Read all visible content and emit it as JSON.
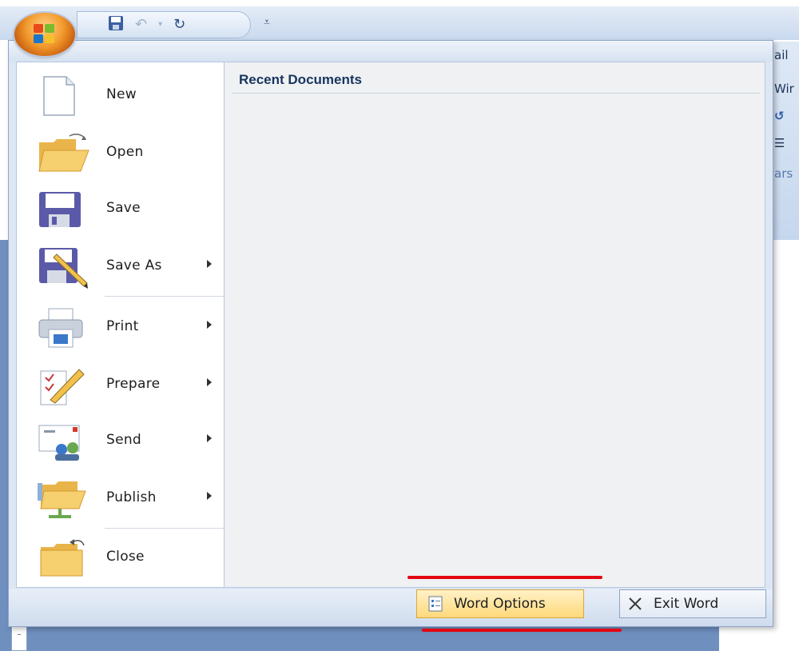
{
  "qat": {
    "save_icon": "save-icon",
    "undo_icon": "undo-icon",
    "dropdown_icon": "chevron-down-icon",
    "redo_icon": "redo-icon",
    "customize_icon": "customize-qat-icon"
  },
  "ribbon_fragments": [
    "ail",
    "Wir",
    "",
    "",
    "ars",
    "",
    ""
  ],
  "menu": {
    "recent_title": "Recent Documents",
    "items": [
      {
        "label": "New",
        "icon": "new-document-icon",
        "submenu": false
      },
      {
        "label": "Open",
        "icon": "open-folder-icon",
        "submenu": false
      },
      {
        "label": "Save",
        "icon": "save-disk-icon",
        "submenu": false
      },
      {
        "label": "Save As",
        "icon": "save-as-icon",
        "submenu": true
      },
      {
        "label": "Print",
        "icon": "printer-icon",
        "submenu": true
      },
      {
        "label": "Prepare",
        "icon": "prepare-icon",
        "submenu": true
      },
      {
        "label": "Send",
        "icon": "send-icon",
        "submenu": true
      },
      {
        "label": "Publish",
        "icon": "publish-icon",
        "submenu": true
      },
      {
        "label": "Close",
        "icon": "close-folder-icon",
        "submenu": false
      }
    ]
  },
  "buttons": {
    "options_label": "Word Options",
    "exit_label": "Exit Word"
  },
  "colors": {
    "annotation_red": "#e30613",
    "office_orange": "#f29a2c",
    "menu_bg": "#dde7f4"
  }
}
